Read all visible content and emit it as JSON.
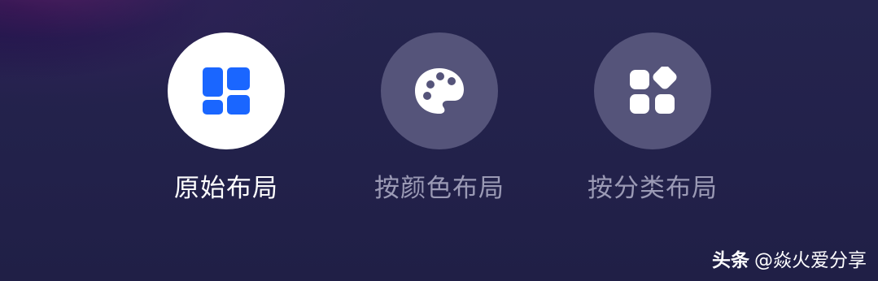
{
  "layout_options": [
    {
      "label": "原始布局",
      "icon": "grid-layout-icon",
      "selected": true
    },
    {
      "label": "按颜色布局",
      "icon": "palette-icon",
      "selected": false
    },
    {
      "label": "按分类布局",
      "icon": "category-icon",
      "selected": false
    }
  ],
  "watermark": {
    "brand": "头条",
    "handle": "@焱火爱分享"
  },
  "colors": {
    "background": "#23224a",
    "accent": "#1a66ff",
    "active_circle": "#ffffff",
    "inactive_circle": "#55547a",
    "inactive_label": "#9b9ab5"
  }
}
